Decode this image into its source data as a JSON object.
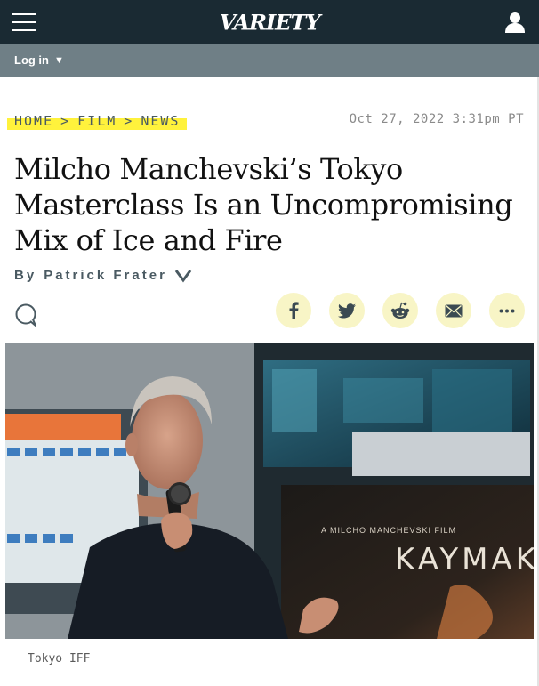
{
  "header": {
    "logo": "VARIETY",
    "menu_icon": "hamburger-menu-icon",
    "account_icon": "user-icon",
    "background": "#1a2a33"
  },
  "subnav": {
    "login_label": "Log in",
    "caret": "▼",
    "background": "#6f7f86"
  },
  "breadcrumb": {
    "items": [
      "HOME",
      "FILM",
      "NEWS"
    ],
    "separator": ">",
    "highlight_color": "#fff23c"
  },
  "article": {
    "timestamp": "Oct 27, 2022 3:31pm PT",
    "headline": "Milcho Manchevski’s Tokyo Masterclass Is an Uncompromising Mix of Ice and Fire",
    "byline_prefix": "By",
    "author": "Patrick Frater",
    "author_expand_icon": "chevron-down-icon",
    "comment_icon": "comment-icon"
  },
  "share": {
    "buttons": [
      "facebook-icon",
      "twitter-icon",
      "reddit-icon",
      "email-icon",
      "more-icon"
    ],
    "button_color": "#f8f5c6",
    "icon_color": "#3b4a52"
  },
  "hero": {
    "poster_text_small": "A MILCHO MANCHEVSKI FILM",
    "poster_title": "KAYMAK",
    "caption": "Tokyo IFF"
  }
}
